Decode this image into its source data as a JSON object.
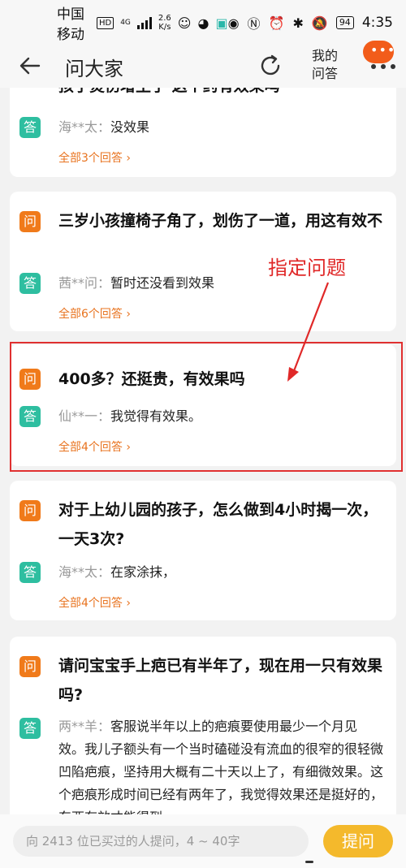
{
  "status_bar": {
    "carrier": "中国移动",
    "hd": "HD",
    "network": "4G",
    "speed_value": "2.6",
    "speed_unit": "K/s",
    "battery": "94",
    "time": "4:35"
  },
  "nav": {
    "title": "问大家",
    "my_questions_line1": "我的",
    "my_questions_line2": "问答",
    "badge_text": "•••"
  },
  "tags": {
    "question": "问",
    "answer": "答"
  },
  "items": [
    {
      "question": "孩子烫伤增生了 这个药有效果吗",
      "answer_user": "海**太：",
      "answer_text": "没效果",
      "all_answers": "全部3个回答 ›"
    },
    {
      "question": "三岁小孩撞椅子角了，划伤了一道，用这有效不",
      "answer_user": "茜**问：",
      "answer_text": "暂时还没看到效果",
      "all_answers": "全部6个回答 ›"
    },
    {
      "question": "400多？还挺贵，有效果吗",
      "answer_user": "仙**一：",
      "answer_text": "我觉得有效果。",
      "all_answers": "全部4个回答 ›"
    },
    {
      "question": "对于上幼儿园的孩子，怎么做到4小时揭一次，一天3次?",
      "answer_user": "海**太：",
      "answer_text": "在家涂抹，",
      "all_answers": "全部4个回答 ›"
    },
    {
      "question": "请问宝宝手上疤已有半年了，现在用一只有效果吗?",
      "answer_user": "两**羊：",
      "answer_text": "客服说半年以上的疤痕要使用最少一个月见效。我儿子额头有一个当时磕碰没有流血的很窄的很轻微凹陷疤痕，坚持用大概有二十天以上了，有细微效果。这个疤痕形成时间已经有两年了，我觉得效果还是挺好的，东西有效才能得到",
      "all_answers": ""
    }
  ],
  "annotation": {
    "label": "指定问题",
    "color": "#e02828"
  },
  "bottom": {
    "placeholder": "向 2413 位已买过的人提问，4 ~ 40字",
    "ask_button": "提问"
  },
  "colors": {
    "question_tag": "#f07a1a",
    "answer_tag": "#2ebea0",
    "link": "#e8731f",
    "ask_button": "#f4b92c",
    "badge": "#f25c1a"
  }
}
